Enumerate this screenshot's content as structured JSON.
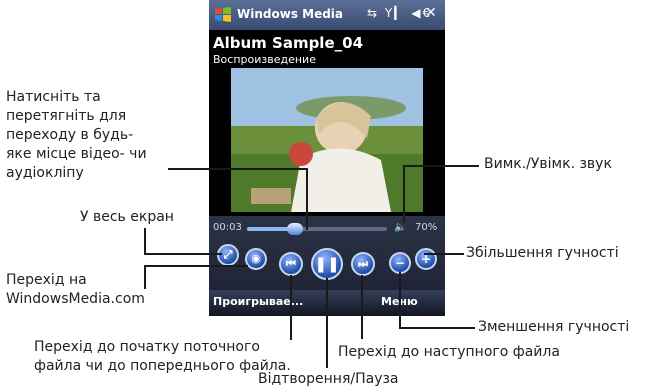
{
  "phone": {
    "app_title": "Windows Media",
    "system_icons": "⇆ Y▎ ◀€",
    "close": "✕",
    "album": "Album Sample_04",
    "status": "Воспроизведение",
    "time": "00:03",
    "volume_percent": "70%",
    "progress_fraction": 0.34,
    "softkey_left": "Проигрывае...",
    "softkey_right": "Меню"
  },
  "annotations": {
    "drag_seek": [
      "Натисніть та",
      "перетягніть для",
      "переходу в будь-",
      "яке місце відео- чи",
      "аудіокліпу"
    ],
    "fullscreen": "У весь екран",
    "windowsmedia": [
      "Перехід на",
      "WindowsMedia.com"
    ],
    "prev_file": [
      "Перехід до початку поточного",
      "файла чи до попереднього файла."
    ],
    "play_pause": "Відтворення/Пауза",
    "next_file": "Перехід до наступного файла",
    "mute": "Вимк./Увімк. звук",
    "vol_up": "Збільшення гучності",
    "vol_down": "Зменшення гучності"
  },
  "colors": {
    "accent": "#1f4ea8",
    "titlebar": "#4a5b82"
  }
}
